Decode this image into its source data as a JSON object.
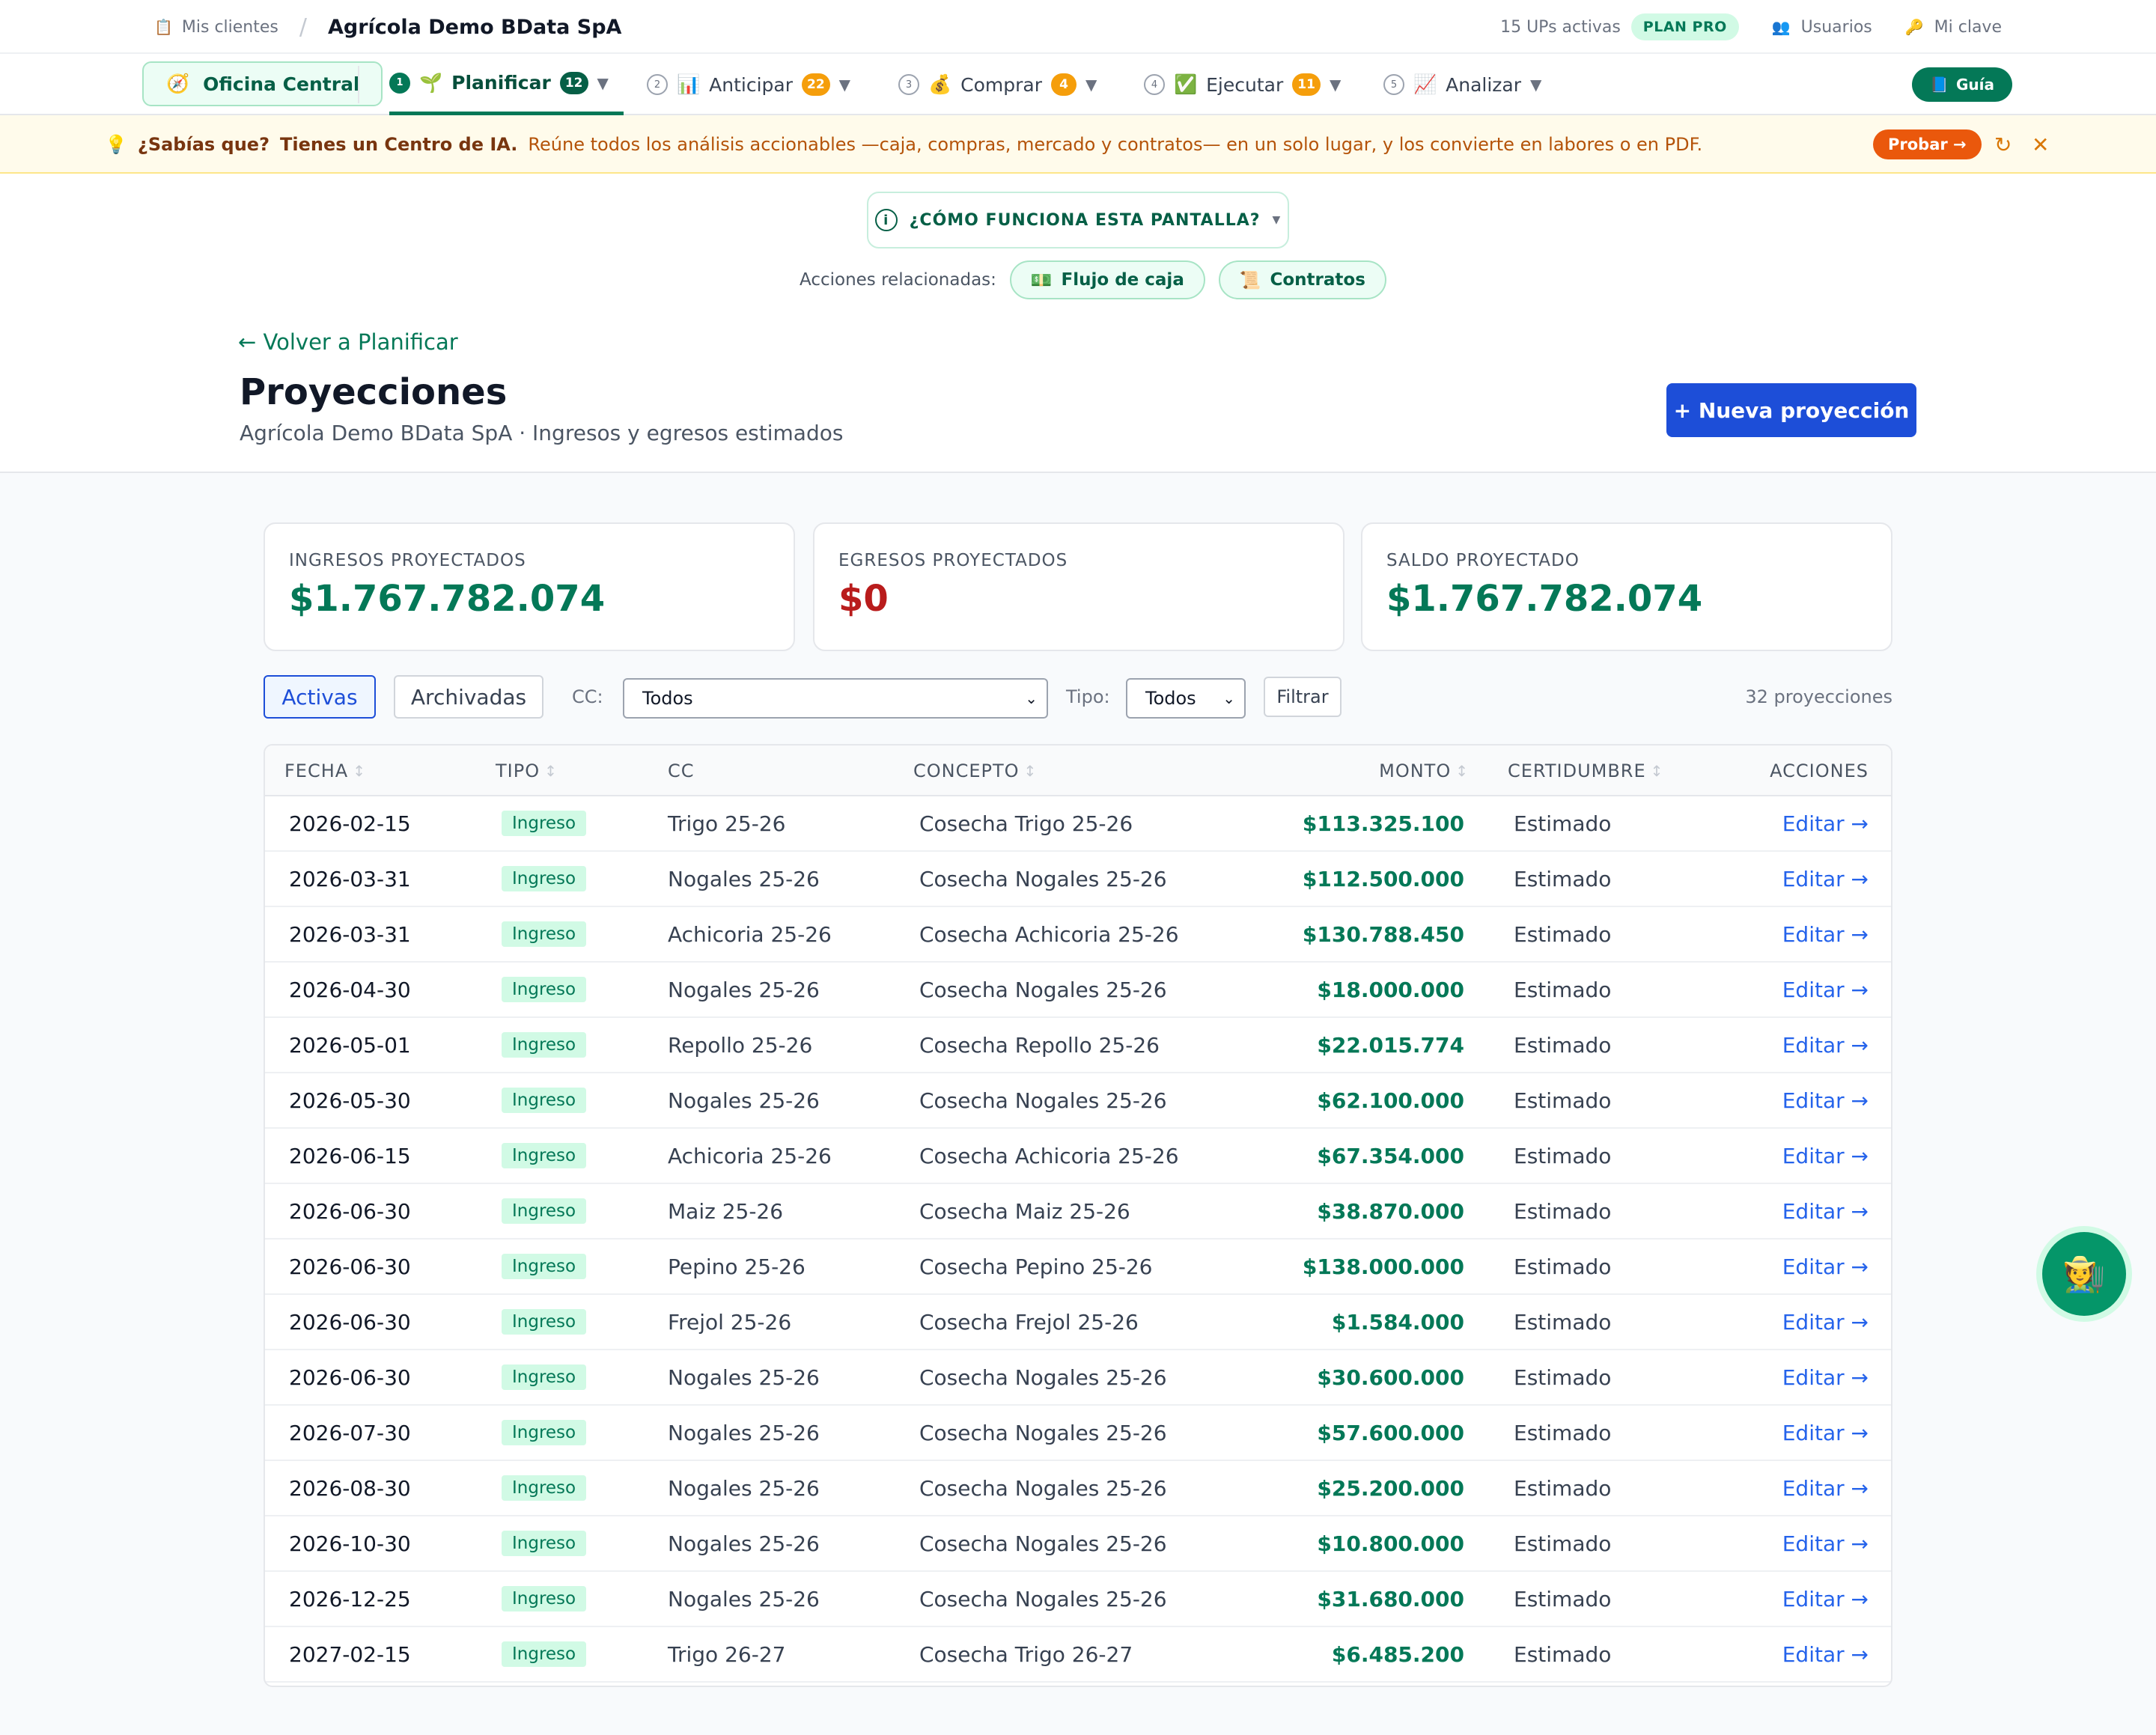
{
  "topbar": {
    "mis_clientes": "Mis clientes",
    "company": "Agrícola Demo BData SpA",
    "ups": "15 UPs activas",
    "plan": "PLAN PRO",
    "usuarios": "Usuarios",
    "mi_clave": "Mi clave"
  },
  "nav": {
    "oficina": "Oficina Central",
    "planificar": {
      "step": "1",
      "label": "Planificar",
      "count": "12"
    },
    "anticipar": {
      "step": "2",
      "label": "Anticipar",
      "count": "22"
    },
    "comprar": {
      "step": "3",
      "label": "Comprar",
      "count": "4"
    },
    "ejecutar": {
      "step": "4",
      "label": "Ejecutar",
      "count": "11"
    },
    "analizar": {
      "step": "5",
      "label": "Analizar"
    },
    "guia": "Guía"
  },
  "banner": {
    "q": "¿Sabías que?",
    "bold": "Tienes un Centro de IA.",
    "text": "Reúne todos los análisis accionables —caja, compras, mercado y contratos— en un solo lugar, y los convierte en labores o en PDF.",
    "probar": "Probar →"
  },
  "header": {
    "como": "¿CÓMO FUNCIONA ESTA PANTALLA?",
    "acciones_label": "Acciones relacionadas:",
    "flujo": "Flujo de caja",
    "contratos": "Contratos",
    "back": "← Volver a Planificar",
    "title": "Proyecciones",
    "subtitle": "Agrícola Demo BData SpA · Ingresos y egresos estimados",
    "nueva": "+ Nueva proyección"
  },
  "cards": {
    "ingresos": {
      "label": "INGRESOS PROYECTADOS",
      "value": "$1.767.782.074",
      "color": "#047857"
    },
    "egresos": {
      "label": "EGRESOS PROYECTADOS",
      "value": "$0",
      "color": "#b91c1c"
    },
    "saldo": {
      "label": "SALDO PROYECTADO",
      "value": "$1.767.782.074",
      "color": "#047857"
    }
  },
  "filters": {
    "activas": "Activas",
    "archivadas": "Archivadas",
    "cc_label": "CC:",
    "cc_value": "Todos",
    "tipo_label": "Tipo:",
    "tipo_value": "Todos",
    "filtrar": "Filtrar",
    "count": "32 proyecciones"
  },
  "table": {
    "headers": {
      "fecha": "FECHA",
      "tipo": "TIPO",
      "cc": "CC",
      "concepto": "CONCEPTO",
      "monto": "MONTO",
      "cert": "CERTIDUMBRE",
      "acciones": "ACCIONES"
    },
    "rows": [
      {
        "fecha": "2026-02-15",
        "tipo": "Ingreso",
        "cc": "Trigo 25-26",
        "concepto": "Cosecha Trigo 25-26",
        "monto": "$113.325.100",
        "cert": "Estimado",
        "accion": "Editar →"
      },
      {
        "fecha": "2026-03-31",
        "tipo": "Ingreso",
        "cc": "Nogales 25-26",
        "concepto": "Cosecha Nogales 25-26",
        "monto": "$112.500.000",
        "cert": "Estimado",
        "accion": "Editar →"
      },
      {
        "fecha": "2026-03-31",
        "tipo": "Ingreso",
        "cc": "Achicoria 25-26",
        "concepto": "Cosecha Achicoria 25-26",
        "monto": "$130.788.450",
        "cert": "Estimado",
        "accion": "Editar →"
      },
      {
        "fecha": "2026-04-30",
        "tipo": "Ingreso",
        "cc": "Nogales 25-26",
        "concepto": "Cosecha Nogales 25-26",
        "monto": "$18.000.000",
        "cert": "Estimado",
        "accion": "Editar →"
      },
      {
        "fecha": "2026-05-01",
        "tipo": "Ingreso",
        "cc": "Repollo 25-26",
        "concepto": "Cosecha Repollo 25-26",
        "monto": "$22.015.774",
        "cert": "Estimado",
        "accion": "Editar →"
      },
      {
        "fecha": "2026-05-30",
        "tipo": "Ingreso",
        "cc": "Nogales 25-26",
        "concepto": "Cosecha Nogales 25-26",
        "monto": "$62.100.000",
        "cert": "Estimado",
        "accion": "Editar →"
      },
      {
        "fecha": "2026-06-15",
        "tipo": "Ingreso",
        "cc": "Achicoria 25-26",
        "concepto": "Cosecha Achicoria 25-26",
        "monto": "$67.354.000",
        "cert": "Estimado",
        "accion": "Editar →"
      },
      {
        "fecha": "2026-06-30",
        "tipo": "Ingreso",
        "cc": "Maiz 25-26",
        "concepto": "Cosecha Maiz 25-26",
        "monto": "$38.870.000",
        "cert": "Estimado",
        "accion": "Editar →"
      },
      {
        "fecha": "2026-06-30",
        "tipo": "Ingreso",
        "cc": "Pepino 25-26",
        "concepto": "Cosecha Pepino 25-26",
        "monto": "$138.000.000",
        "cert": "Estimado",
        "accion": "Editar →"
      },
      {
        "fecha": "2026-06-30",
        "tipo": "Ingreso",
        "cc": "Frejol 25-26",
        "concepto": "Cosecha Frejol 25-26",
        "monto": "$1.584.000",
        "cert": "Estimado",
        "accion": "Editar →"
      },
      {
        "fecha": "2026-06-30",
        "tipo": "Ingreso",
        "cc": "Nogales 25-26",
        "concepto": "Cosecha Nogales 25-26",
        "monto": "$30.600.000",
        "cert": "Estimado",
        "accion": "Editar →"
      },
      {
        "fecha": "2026-07-30",
        "tipo": "Ingreso",
        "cc": "Nogales 25-26",
        "concepto": "Cosecha Nogales 25-26",
        "monto": "$57.600.000",
        "cert": "Estimado",
        "accion": "Editar →"
      },
      {
        "fecha": "2026-08-30",
        "tipo": "Ingreso",
        "cc": "Nogales 25-26",
        "concepto": "Cosecha Nogales 25-26",
        "monto": "$25.200.000",
        "cert": "Estimado",
        "accion": "Editar →"
      },
      {
        "fecha": "2026-10-30",
        "tipo": "Ingreso",
        "cc": "Nogales 25-26",
        "concepto": "Cosecha Nogales 25-26",
        "monto": "$10.800.000",
        "cert": "Estimado",
        "accion": "Editar →"
      },
      {
        "fecha": "2026-12-25",
        "tipo": "Ingreso",
        "cc": "Nogales 25-26",
        "concepto": "Cosecha Nogales 25-26",
        "monto": "$31.680.000",
        "cert": "Estimado",
        "accion": "Editar →"
      },
      {
        "fecha": "2027-02-15",
        "tipo": "Ingreso",
        "cc": "Trigo 26-27",
        "concepto": "Cosecha Trigo 26-27",
        "monto": "$6.485.200",
        "cert": "Estimado",
        "accion": "Editar →"
      }
    ]
  },
  "icons": {
    "clipboard": "clipboard-icon",
    "users": "users-icon",
    "key": "key-icon",
    "compass": "compass-icon",
    "sprout": "sprout-icon",
    "chart": "bar-chart-icon",
    "money_bag": "money-bag-icon",
    "check": "check-box-icon",
    "trend": "trend-chart-icon",
    "book": "book-icon",
    "bulb": "lightbulb-icon",
    "refresh": "refresh-icon",
    "close": "close-icon",
    "info": "info-icon",
    "cash": "cash-icon",
    "scroll": "scroll-icon",
    "farmer": "farmer-icon"
  }
}
